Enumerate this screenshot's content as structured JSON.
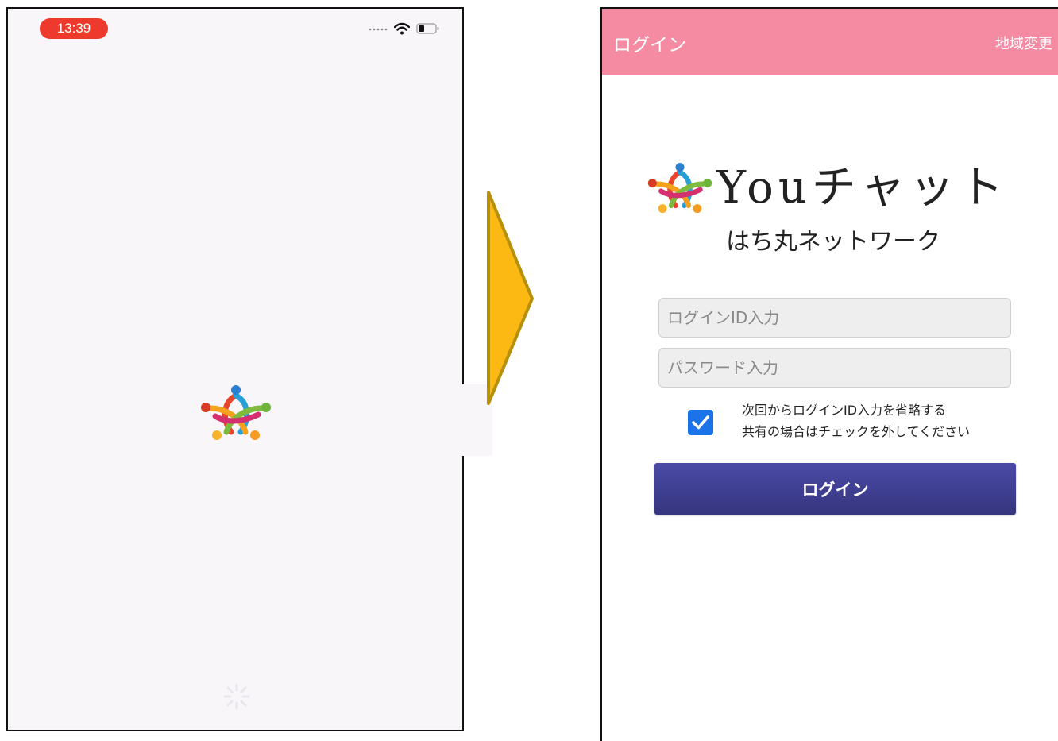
{
  "splash": {
    "time": "13:39",
    "status_icons": [
      "signal-dots-icon",
      "wifi-icon",
      "battery-icon"
    ]
  },
  "transition": {
    "icon": "right-arrow-icon",
    "color": "#fdb913"
  },
  "login": {
    "appbar": {
      "title": "ログイン",
      "region_button": "地域変更",
      "color": "#f48ba3"
    },
    "brand": {
      "title": "Youチャット",
      "subtitle": "はち丸ネットワーク"
    },
    "form": {
      "login_id_placeholder": "ログインID入力",
      "password_placeholder": "パスワード入力",
      "remember_checked": true,
      "remember_line1": "次回からログインID入力を省略する",
      "remember_line2": "共有の場合はチェックを外してください",
      "submit_label": "ログイン"
    },
    "accent_color": "#3d3d91"
  }
}
